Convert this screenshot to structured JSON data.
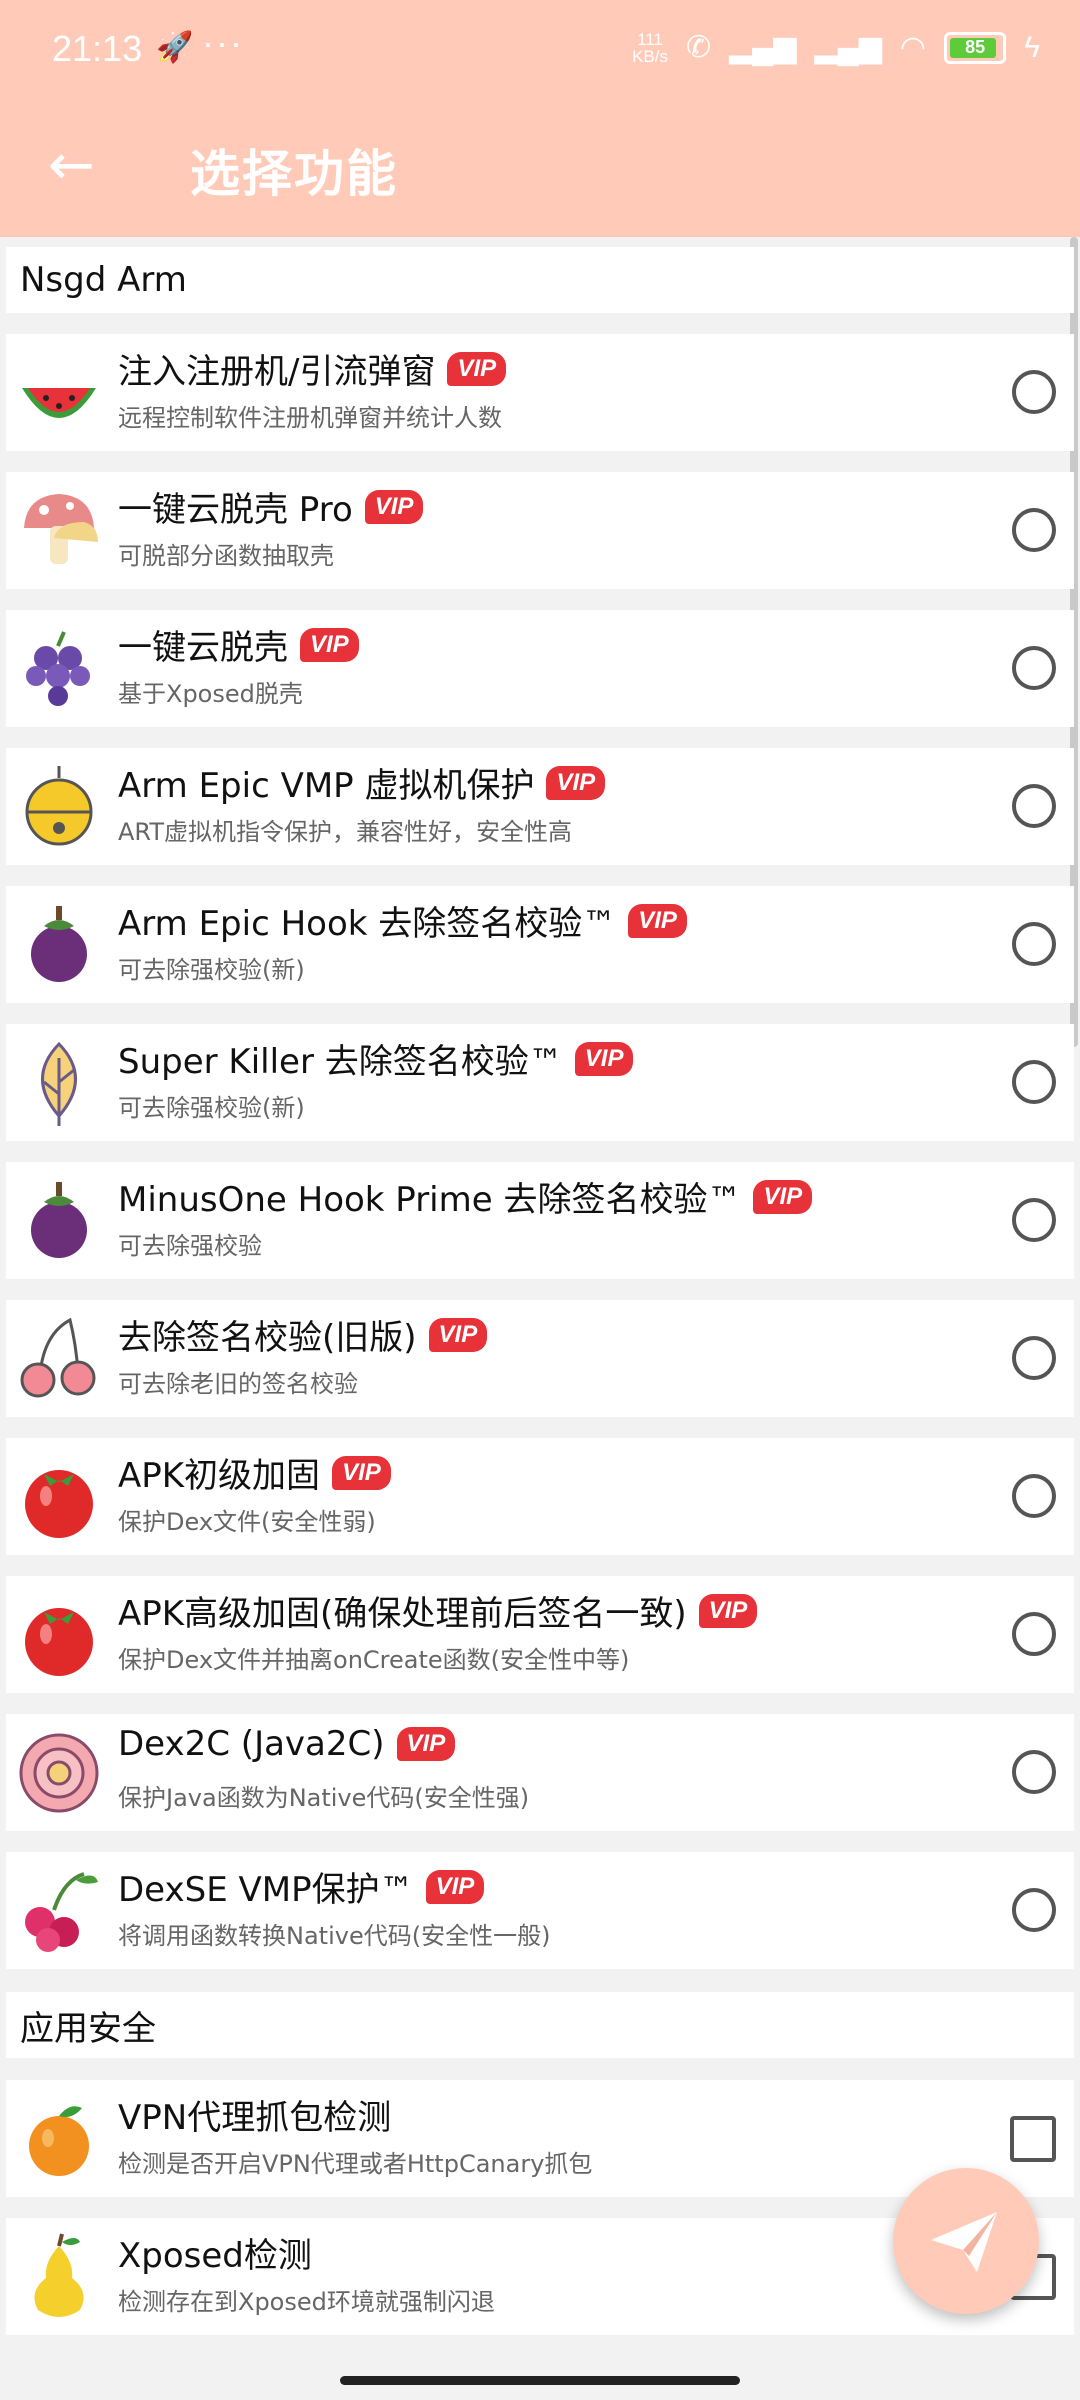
{
  "status": {
    "time": "21:13",
    "speed_top": "111",
    "speed_unit": "KB/s",
    "battery": "85"
  },
  "app": {
    "title": "选择功能"
  },
  "sections": [
    {
      "header": "Nsgd Arm",
      "items": [
        {
          "name": "注入注册机/引流弹窗",
          "vip": "VIP",
          "desc": "远程控制软件注册机弹窗并统计人数",
          "icon": "watermelon-icon"
        },
        {
          "name": "一键云脱壳 Pro",
          "vip": "VIP",
          "desc": "可脱部分函数抽取壳",
          "icon": "mushroom-icon"
        },
        {
          "name": "一键云脱壳",
          "vip": "VIP",
          "desc": "基于Xposed脱壳",
          "icon": "grapes-icon"
        },
        {
          "name": "Arm Epic VMP 虚拟机保护",
          "vip": "VIP",
          "desc": "ART虚拟机指令保护，兼容性好，安全性高",
          "icon": "bell-icon"
        },
        {
          "name": "Arm Epic Hook 去除签名校验™",
          "vip": "VIP",
          "desc": "可去除强校验(新)",
          "icon": "mangosteen-icon"
        },
        {
          "name": "Super Killer 去除签名校验™",
          "vip": "VIP",
          "desc": "可去除强校验(新)",
          "icon": "leaf-icon"
        },
        {
          "name": "MinusOne Hook Prime 去除签名校验™",
          "vip": "VIP",
          "desc": "可去除强校验",
          "icon": "mangosteen-icon"
        },
        {
          "name": "去除签名校验(旧版)",
          "vip": "VIP",
          "desc": "可去除老旧的签名校验",
          "icon": "cherries-icon"
        },
        {
          "name": "APK初级加固",
          "vip": "VIP",
          "desc": "保护Dex文件(安全性弱)",
          "icon": "tomato-icon"
        },
        {
          "name": "APK高级加固(确保处理前后签名一致)",
          "vip": "VIP",
          "desc": "保护Dex文件并抽离onCreate函数(安全性中等)",
          "icon": "tomato-icon"
        },
        {
          "name": "Dex2C (Java2C)",
          "vip": "VIP",
          "desc": "保护Java函数为Native代码(安全性强)",
          "icon": "rose-icon"
        },
        {
          "name": "DexSE VMP保护™",
          "vip": "VIP",
          "desc": "将调用函数转换Native代码(安全性一般)",
          "icon": "cherry-cluster-icon"
        }
      ]
    },
    {
      "header": "应用安全",
      "items": [
        {
          "name": "VPN代理抓包检测",
          "desc": "检测是否开启VPN代理或者HttpCanary抓包",
          "icon": "orange-icon"
        },
        {
          "name": "Xposed检测",
          "desc": "检测存在到Xposed环境就强制闪退",
          "icon": "pear-icon"
        }
      ]
    }
  ],
  "colors": {
    "accent": "#ffcbb8",
    "vip": "#e8323a"
  }
}
